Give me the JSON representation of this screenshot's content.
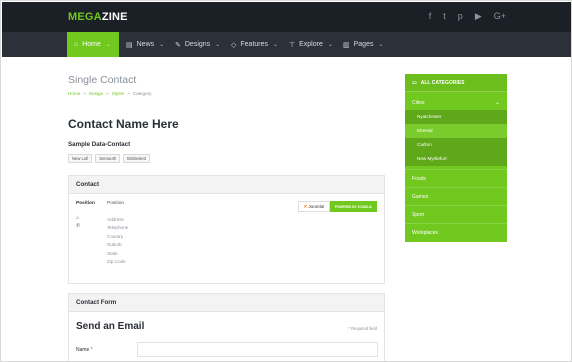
{
  "brand": {
    "part1": "MEGA",
    "part2": "ZINE"
  },
  "social": [
    {
      "icon": "facebook-icon",
      "glyph": "f"
    },
    {
      "icon": "twitter-icon",
      "glyph": "t"
    },
    {
      "icon": "pinterest-icon",
      "glyph": "p"
    },
    {
      "icon": "youtube-icon",
      "glyph": "▶"
    },
    {
      "icon": "google-plus-icon",
      "glyph": "G+"
    }
  ],
  "nav": {
    "home": "Home",
    "news": "News",
    "designs": "Designs",
    "features": "Features",
    "explore": "Explore",
    "pages": "Pages"
  },
  "page": {
    "title": "Single Contact",
    "breadcrumb": [
      "Home",
      "Design",
      "Styles",
      "Category"
    ],
    "contact_name": "Contact Name Here",
    "sample": "Sample Data-Contact",
    "tags": [
      "New Lofi",
      "Semouth",
      "Birdtested"
    ]
  },
  "contact_panel": {
    "heading": "Contact",
    "position_label": "Position",
    "position_value": "Position",
    "address_lines": [
      "Address",
      "Telephone",
      "Country",
      "Suburb",
      "State",
      "Zip Code"
    ],
    "badge_left": "Joomla!",
    "badge_right": "POWERED BY JOOMLA!"
  },
  "form_panel": {
    "heading": "Contact Form",
    "title": "Send an Email",
    "required_note": "Required field",
    "name_label": "Name"
  },
  "sidebar": {
    "heading": "ALL CATEGORIES",
    "cities": "Cities",
    "city_items": [
      "Nyatchester",
      "Elreetal",
      "Carlton",
      "New Myrtlefurt"
    ],
    "categories": [
      "Foods",
      "Games",
      "Sport",
      "Workplaces"
    ]
  },
  "colors": {
    "accent": "#71c81e",
    "topbar": "#1b1f26",
    "nav": "#2b3039"
  }
}
